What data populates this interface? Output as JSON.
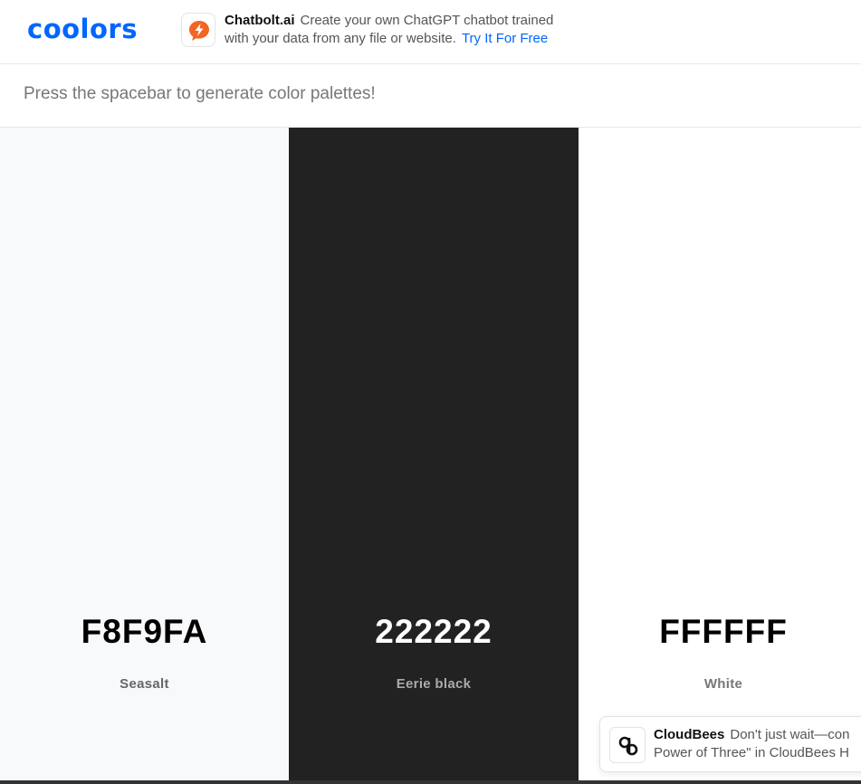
{
  "header": {
    "logo_text": "coolors",
    "ad": {
      "brand": "Chatbolt.ai",
      "line1": "Create your own ChatGPT chatbot trained",
      "line2": "with your data from any file or website.",
      "link": "Try It For Free",
      "icon": "lightning-bolt-icon",
      "icon_color": "#f26522"
    }
  },
  "hint": "Press the spacebar to generate color palettes!",
  "palette": [
    {
      "hex": "F8F9FA",
      "name": "Seasalt",
      "color": "#F8F9FA",
      "text_color": "#000000",
      "name_color": "#666666"
    },
    {
      "hex": "222222",
      "name": "Eerie black",
      "color": "#222222",
      "text_color": "#ffffff",
      "name_color": "#aaaaaa"
    },
    {
      "hex": "FFFFFF",
      "name": "White",
      "color": "#FFFFFF",
      "text_color": "#000000",
      "name_color": "#777777"
    }
  ],
  "toast": {
    "brand": "CloudBees",
    "line1": "Don't just wait—con",
    "line2": "Power of Three\" in CloudBees H",
    "icon": "cloudbees-logo-icon"
  },
  "colors": {
    "brand_blue": "#0066ff",
    "ad_orange": "#f26522"
  }
}
